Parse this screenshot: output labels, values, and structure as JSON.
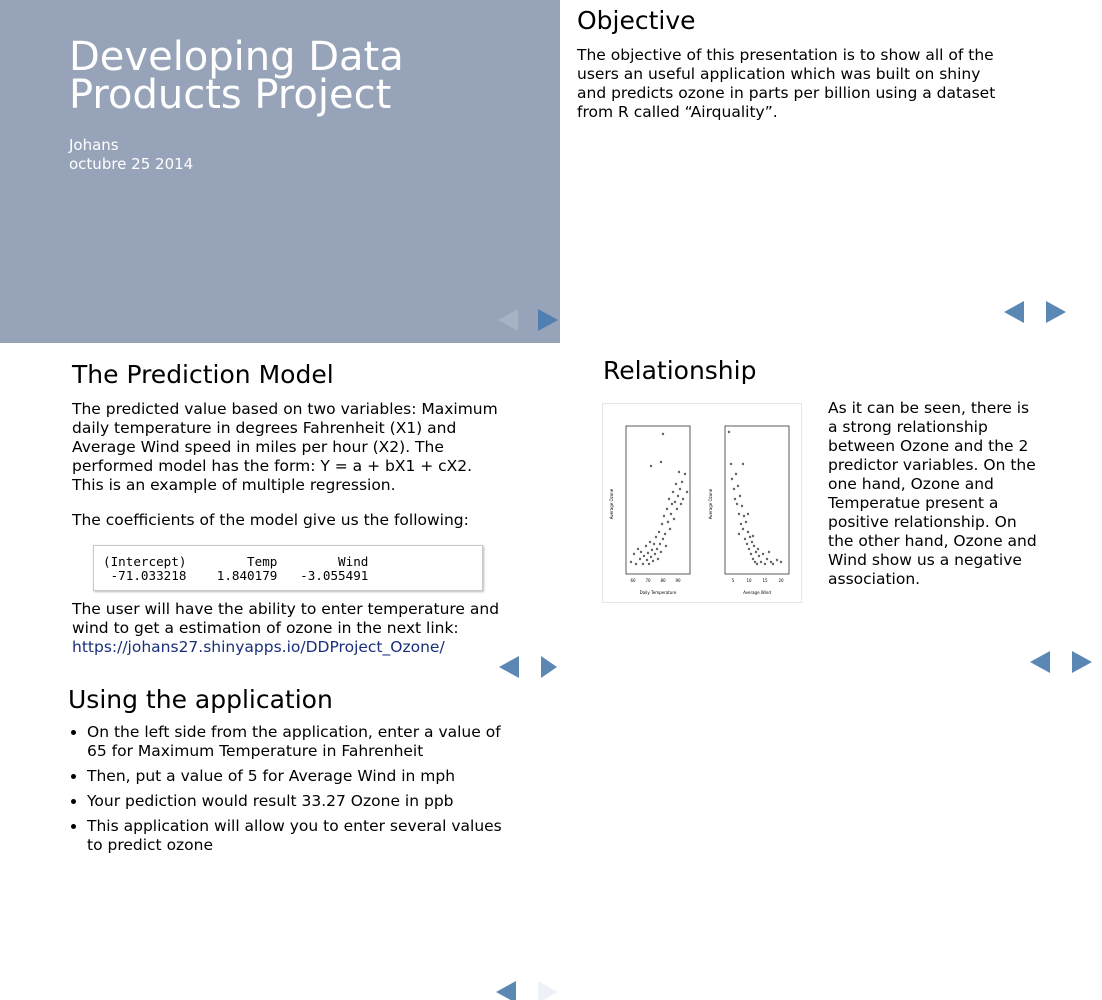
{
  "slide1": {
    "title_line1": "Developing Data",
    "title_line2": "Products Project",
    "author": "Johans",
    "date": "octubre 25 2014"
  },
  "slide2": {
    "heading": "Objective",
    "body": "The objective of this presentation is to show all of the users an useful application which was built on shiny and predicts ozone in parts per billion using a dataset from R called “Airquality”."
  },
  "slide3": {
    "heading": "The Prediction Model",
    "para1": "The predicted value based on two variables: Maximum daily temperature in degrees Fahrenheit (X1) and Average Wind speed in miles per hour (X2). The performed model has the form: Y = a + bX1 + cX2. This is an example of multiple regression.",
    "para2": "The coefficients of the model give us the following:",
    "code_line1": "(Intercept)        Temp        Wind",
    "code_line2": " -71.033218    1.840179   -3.055491",
    "para3": "The user will have the ability to enter temperature and wind to get a estimation of ozone in the next link:",
    "link": "https://johans27.shinyapps.io/DDProject_Ozone/"
  },
  "slide4": {
    "heading": "Relationship",
    "body": "As it can be seen, there is a strong relationship between Ozone and the 2 predictor variables. On the one hand, Ozone and Temperatue present a positive relationship. On the other hand, Ozone and Wind show us a negative association.",
    "plot_left_xlabel": "Daily Temperature",
    "plot_right_xlabel": "Average Wind",
    "plot_ylabel": "Average Ozone",
    "left_ticks": [
      "60",
      "70",
      "80",
      "90"
    ],
    "right_ticks": [
      "5",
      "10",
      "15",
      "20"
    ]
  },
  "slide5": {
    "heading": "Using the application",
    "bullets": [
      "On the left side from the application, enter a value of 65 for Maximum Temperature in Fahrenheit",
      "Then, put a value of 5 for Average Wind in mph",
      "Your pediction would result 33.27 Ozone in ppb",
      "This application will allow you to enter several values to predict ozone"
    ]
  },
  "colors": {
    "title_slide_bg": "#97a3b8",
    "nav_arrow": "#5b87b5",
    "link": "#1a2f7a"
  }
}
